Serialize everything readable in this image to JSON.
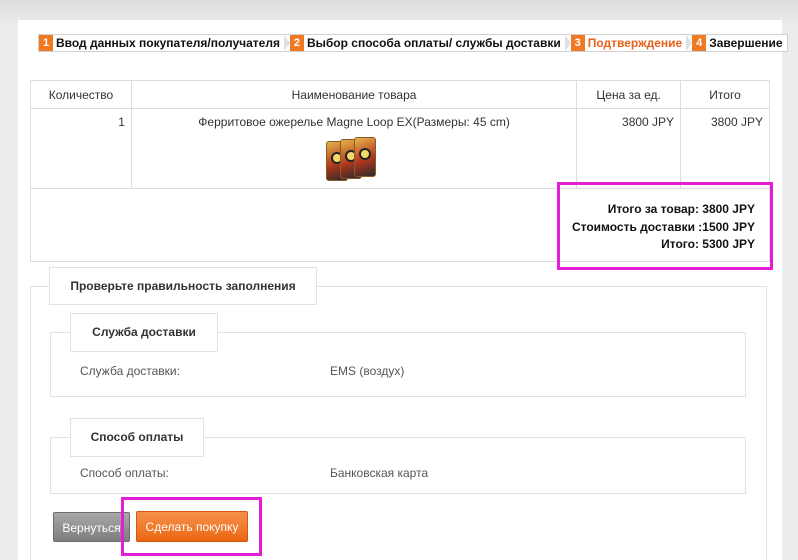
{
  "steps": [
    {
      "num": "1",
      "label": "Ввод данных покупателя/получателя"
    },
    {
      "num": "2",
      "label": "Выбор способа оплаты/ службы доставки"
    },
    {
      "num": "3",
      "label": "Подтверждение"
    },
    {
      "num": "4",
      "label": "Завершение"
    }
  ],
  "table": {
    "headers": [
      "Количество",
      "Наименование товара",
      "Цена за ед.",
      "Итого"
    ],
    "rows": [
      {
        "qty": "1",
        "name": "Ферритовое ожерелье Magne Loop EX(Размеры: 45 cm)",
        "price": "3800 JPY",
        "total": "3800 JPY"
      }
    ]
  },
  "summary": {
    "goods": "Итого за товар: 3800 JPY",
    "shipping": "Стоимость доставки :1500 JPY",
    "grand": "Итого: 5300 JPY"
  },
  "confirm": {
    "title": "Проверьте правильность заполнения",
    "shipping_section": {
      "title": "Служба доставки",
      "label": "Служба доставки:",
      "value": "EMS (воздух)"
    },
    "payment_section": {
      "title": "Способ оплаты",
      "label": "Способ оплаты:",
      "value": "Банковская карта"
    }
  },
  "buttons": {
    "back": "Вернуться",
    "buy": "Сделать покупку"
  },
  "colors": {
    "accent": "#f07a21",
    "active_step": "#e8621a",
    "highlight": "#e51ed6"
  }
}
